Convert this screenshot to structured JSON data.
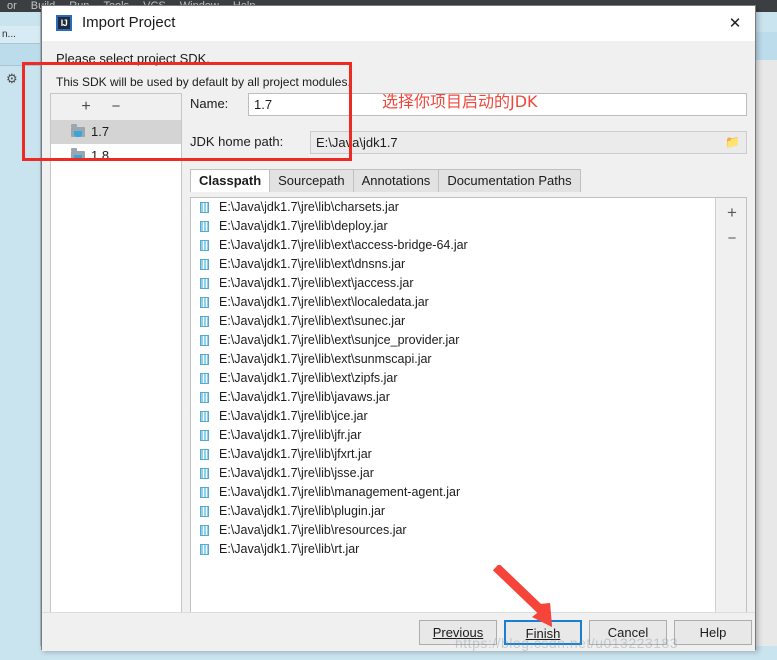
{
  "ide": {
    "menu_items": [
      "or",
      "Build",
      "Run",
      "Tools",
      "VCS",
      "Window",
      "Help"
    ],
    "left_tab_label": "n...",
    "gear_icon": "gear-icon"
  },
  "dialog": {
    "icon_text": "IJ",
    "title": "Import Project",
    "close_label": "✕",
    "prompt": "Please select project SDK.",
    "subprompt": "This SDK will be used by default by all project modules.",
    "sdk_toolbar": {
      "add_label": "+",
      "remove_label": "−"
    },
    "sdk_items": [
      {
        "label": "1.7",
        "selected": true
      },
      {
        "label": "1.8",
        "selected": false
      }
    ],
    "name_field": {
      "label": "Name:",
      "value": "1.7"
    },
    "jdk_path_field": {
      "label": "JDK home path:",
      "value": "E:\\Java\\jdk1.7",
      "browse_icon": "folder-browse-icon"
    },
    "tabs": [
      {
        "label": "Classpath",
        "active": true
      },
      {
        "label": "Sourcepath",
        "active": false
      },
      {
        "label": "Annotations",
        "active": false
      },
      {
        "label": "Documentation Paths",
        "active": false
      }
    ],
    "classpath_side": {
      "add_label": "+",
      "remove_label": "−"
    },
    "classpath_items": [
      "E:\\Java\\jdk1.7\\jre\\lib\\charsets.jar",
      "E:\\Java\\jdk1.7\\jre\\lib\\deploy.jar",
      "E:\\Java\\jdk1.7\\jre\\lib\\ext\\access-bridge-64.jar",
      "E:\\Java\\jdk1.7\\jre\\lib\\ext\\dnsns.jar",
      "E:\\Java\\jdk1.7\\jre\\lib\\ext\\jaccess.jar",
      "E:\\Java\\jdk1.7\\jre\\lib\\ext\\localedata.jar",
      "E:\\Java\\jdk1.7\\jre\\lib\\ext\\sunec.jar",
      "E:\\Java\\jdk1.7\\jre\\lib\\ext\\sunjce_provider.jar",
      "E:\\Java\\jdk1.7\\jre\\lib\\ext\\sunmscapi.jar",
      "E:\\Java\\jdk1.7\\jre\\lib\\ext\\zipfs.jar",
      "E:\\Java\\jdk1.7\\jre\\lib\\javaws.jar",
      "E:\\Java\\jdk1.7\\jre\\lib\\jce.jar",
      "E:\\Java\\jdk1.7\\jre\\lib\\jfr.jar",
      "E:\\Java\\jdk1.7\\jre\\lib\\jfxrt.jar",
      "E:\\Java\\jdk1.7\\jre\\lib\\jsse.jar",
      "E:\\Java\\jdk1.7\\jre\\lib\\management-agent.jar",
      "E:\\Java\\jdk1.7\\jre\\lib\\plugin.jar",
      "E:\\Java\\jdk1.7\\jre\\lib\\resources.jar",
      "E:\\Java\\jdk1.7\\jre\\lib\\rt.jar"
    ],
    "buttons": {
      "previous": "Previous",
      "finish": "Finish",
      "cancel": "Cancel",
      "help": "Help",
      "focused": "Finish"
    }
  },
  "annotations": {
    "note_text": "选择你项目启动的JDK",
    "box_color": "#ee2b22",
    "arrow_color": "#f5443a",
    "watermark": "https://blog.csdn.net/u013223183"
  }
}
